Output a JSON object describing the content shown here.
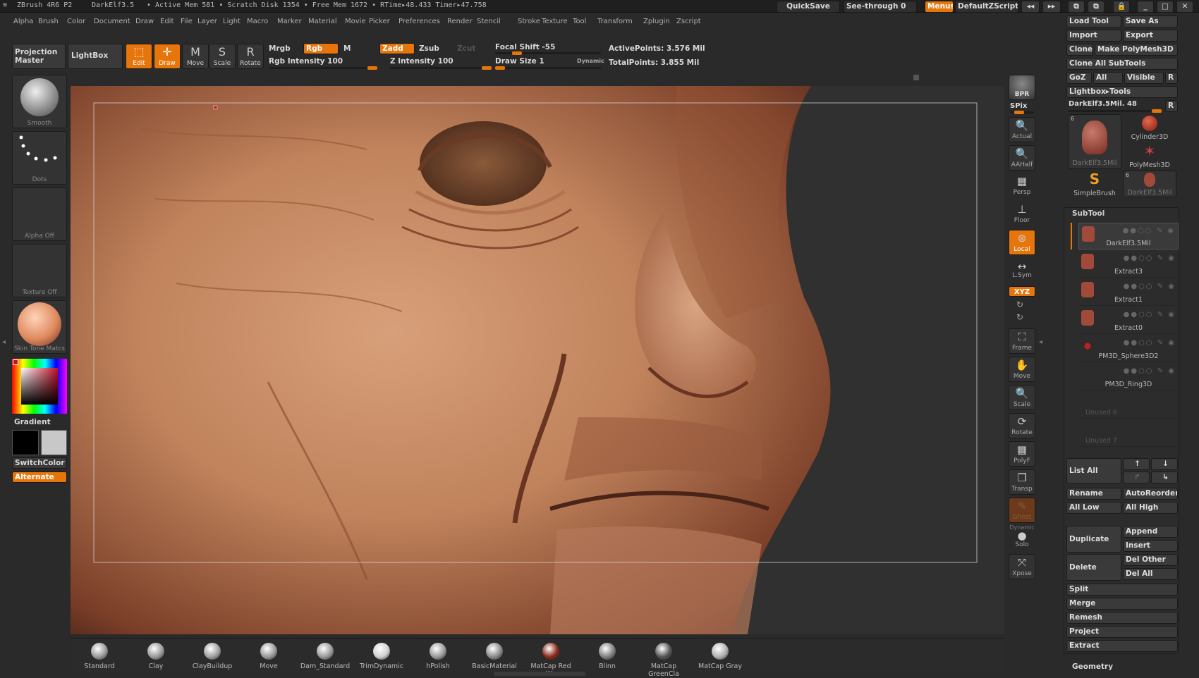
{
  "titlebar": {
    "app": "ZBrush 4R6 P2",
    "doc": "DarkElf3.5",
    "stats": "• Active Mem 581  • Scratch Disk 1354  • Free Mem 1672  • RTime▸48.433  Timer▸47.758",
    "quicksave": "QuickSave",
    "seethrough": "See-through  0",
    "menus": "Menus",
    "script": "DefaultZScript"
  },
  "menu": [
    "Alpha",
    "Brush",
    "Color",
    "Document",
    "Draw",
    "Edit",
    "File",
    "Layer",
    "Light",
    "Macro",
    "Marker",
    "Material",
    "Movie",
    "Picker",
    "Preferences",
    "Render",
    "Stencil",
    "Stroke",
    "Texture",
    "Tool",
    "Transform",
    "Zplugin",
    "Zscript"
  ],
  "toolbar": {
    "projection_master": "Projection Master",
    "lightbox": "LightBox",
    "edit": "Edit",
    "draw": "Draw",
    "move": "Move",
    "scale": "Scale",
    "rotate": "Rotate",
    "mrgb": "Mrgb",
    "rgb": "Rgb",
    "m": "M",
    "zadd": "Zadd",
    "zsub": "Zsub",
    "zcut": "Zcut",
    "rgb_intensity": "Rgb  Intensity 100",
    "z_intensity": "Z  Intensity 100",
    "focal_shift": "Focal  Shift -55",
    "draw_size": "Draw  Size 1",
    "dynamic": "Dynamic",
    "active_points": "ActivePoints: 3.576  Mil",
    "total_points": "TotalPoints: 3.855  Mil"
  },
  "left": {
    "smooth": "Smooth",
    "dots": "Dots",
    "alpha": "Alpha  Off",
    "texture": "Texture  Off",
    "material": "Skin Tone Matcs",
    "gradient": "Gradient",
    "switchcolor": "SwitchColor",
    "alternate": "Alternate"
  },
  "shelf": [
    {
      "label": "Standard",
      "color": "#9a9a9a"
    },
    {
      "label": "Clay",
      "color": "#9a9a9a"
    },
    {
      "label": "ClayBuildup",
      "color": "#a0a0a0"
    },
    {
      "label": "Move",
      "color": "#9a9a9a"
    },
    {
      "label": "Dam_Standard",
      "color": "#9a9a9a"
    },
    {
      "label": "TrimDynamic",
      "color": "#d0d0d0"
    },
    {
      "label": "hPolish",
      "color": "#9a9a9a"
    },
    {
      "label": "BasicMaterial",
      "color": "#8a8a8a"
    },
    {
      "label": "MatCap  Red  Wa",
      "color": "#8a2a1a"
    },
    {
      "label": "Blinn",
      "color": "#808080"
    },
    {
      "label": "MatCap  GreenCla",
      "color": "#555"
    },
    {
      "label": "MatCap  Gray",
      "color": "#b0b0b0"
    }
  ],
  "rightbar": {
    "bpr": "BPR",
    "spix": "SPix",
    "actual": "Actual",
    "aahalf": "AAHalf",
    "persp": "Persp",
    "floor": "Floor",
    "local": "Local",
    "lsym": "L.Sym",
    "xyz": "XYZ",
    "frame": "Frame",
    "move": "Move",
    "scale": "Scale",
    "rotate": "Rotate",
    "polyf": "PolyF",
    "transp": "Transp",
    "ghost": "Ghost",
    "solo": "Solo",
    "dynamic": "Dynamic",
    "xpose": "Xpose"
  },
  "tool": {
    "load": "Load  Tool",
    "save": "Save  As",
    "import": "Import",
    "export": "Export",
    "clone": "Clone",
    "make_polymesh": "Make  PolyMesh3D",
    "clone_all": "Clone  All  SubTools",
    "goz": "GoZ",
    "all": "All",
    "visible": "Visible",
    "r": "R",
    "lightbox_tools": "Lightbox▸Tools",
    "current": "DarkElf3.5Mil. 48",
    "thumbs": [
      {
        "label": "DarkElf3.5Mil",
        "badge": "6"
      },
      {
        "label": "Cylinder3D",
        "badge": ""
      },
      {
        "label": "PolyMesh3D",
        "badge": ""
      },
      {
        "label": "SimpleBrush",
        "badge": ""
      },
      {
        "label": "DarkElf3.5Mil",
        "badge": "6"
      }
    ]
  },
  "subtool": {
    "header": "SubTool",
    "items": [
      "DarkElf3.5Mil",
      "Extract3",
      "Extract1",
      "Extract0",
      "PM3D_Sphere3D2",
      "PM3D_Ring3D",
      "Unused  6",
      "Unused  7"
    ],
    "list_all": "List  All",
    "rename": "Rename",
    "autoreorder": "AutoReorder",
    "all_low": "All  Low",
    "all_high": "All  High",
    "duplicate": "Duplicate",
    "append": "Append",
    "insert": "Insert",
    "delete": "Delete",
    "del_other": "Del  Other",
    "del_all": "Del  All",
    "split": "Split",
    "merge": "Merge",
    "remesh": "Remesh",
    "project": "Project",
    "extract": "Extract",
    "geometry": "Geometry"
  }
}
